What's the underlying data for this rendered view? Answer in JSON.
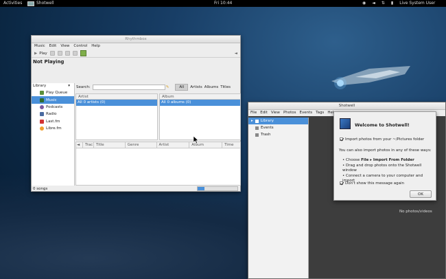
{
  "topbar": {
    "activities": "Activities",
    "app_name": "Shotwell",
    "clock": "Fri 10:44",
    "user": "Live System User"
  },
  "music": {
    "menu": [
      "Music",
      "Edit",
      "View",
      "Control",
      "Help"
    ],
    "play_label": "Play",
    "status_title": "Not Playing",
    "sidebar_header": "Library",
    "sidebar_items": [
      "Play Queue",
      "Music",
      "Podcasts",
      "Radio",
      "Last.fm",
      "Libre.fm"
    ],
    "search_label": "Search:",
    "search_value": "",
    "filter_tabs": [
      "All",
      "Artists",
      "Albums",
      "Titles"
    ],
    "artist_header": "Artist",
    "artist_row": "All 0 artists (0)",
    "album_header": "Album",
    "album_row": "All 0 albums (0)",
    "track_cols": [
      "Trac",
      "Title",
      "Genre",
      "Artist",
      "Album",
      "Time"
    ],
    "status_bar": "0 songs"
  },
  "shotwell": {
    "title": "Shotwell",
    "menu": [
      "File",
      "Edit",
      "View",
      "Photos",
      "Events",
      "Tags",
      "Help"
    ],
    "sidebar_items": [
      "Library",
      "Events",
      "Trash"
    ],
    "no_photos": "No photos/videos"
  },
  "dialog": {
    "title": "Welcome to Shotwell!",
    "import_label": "Import photos from your ~/Pictures folder",
    "also_text": "You can also import photos in any of these ways:",
    "bullet1_prefix": "Choose ",
    "bullet1_menu": "File ▸ Import From Folder",
    "bullet2": "Drag and drop photos onto the Shotwell window",
    "bullet3": "Connect a camera to your computer and import",
    "dont_show": "Don't show this message again",
    "ok": "OK"
  }
}
